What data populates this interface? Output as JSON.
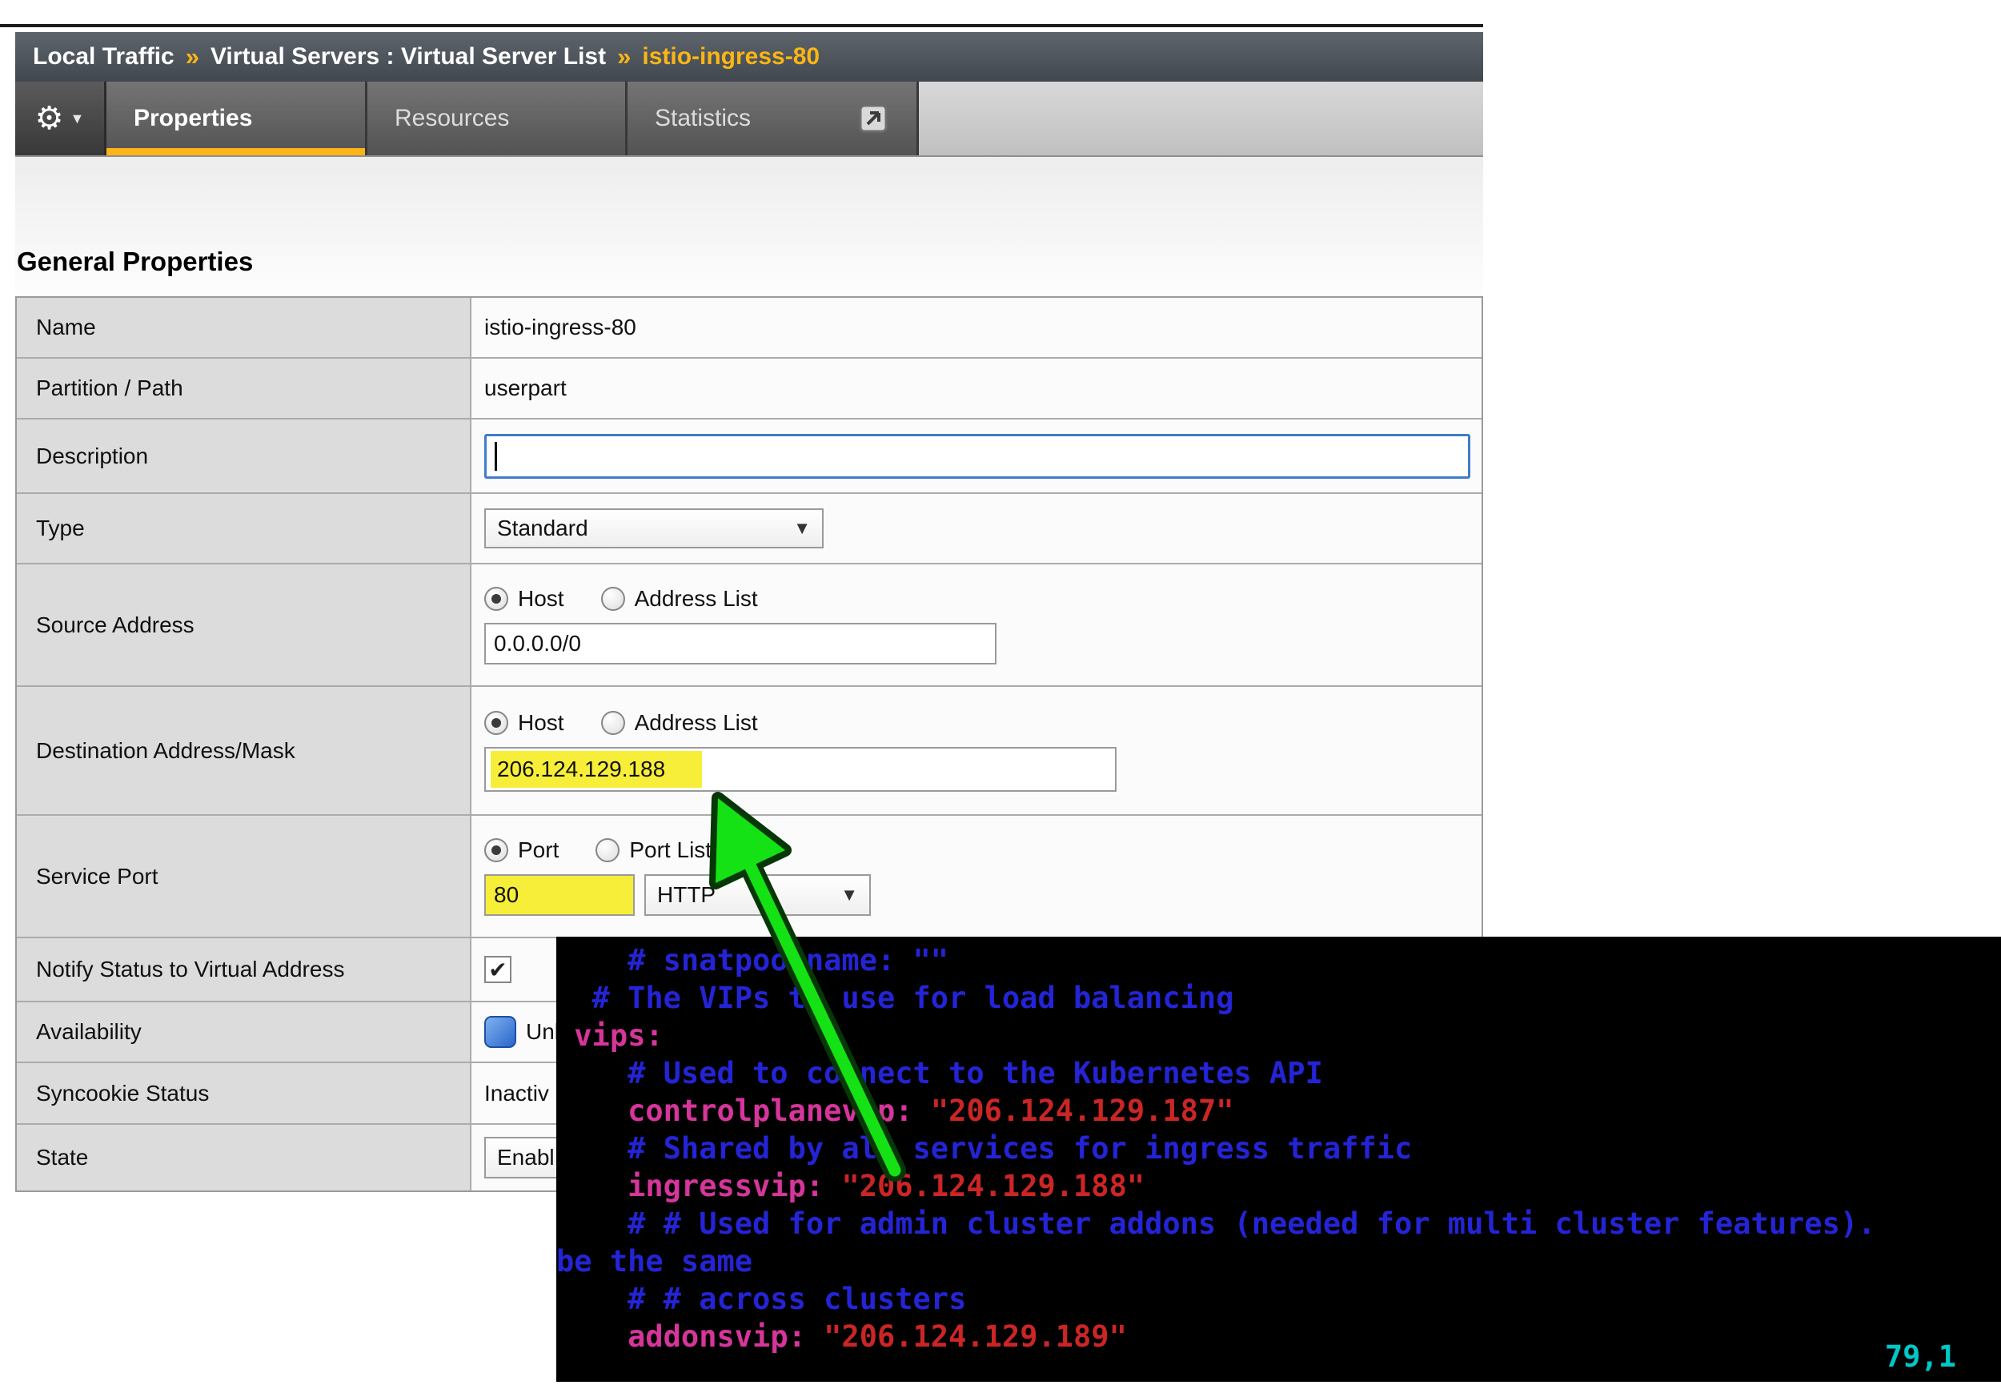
{
  "colors": {
    "accent-yellow": "#fdb515",
    "highlight": "#f7ee3a",
    "arrow-green": "#15e215",
    "term-comment": "#2424d6",
    "term-key": "#d6359b",
    "term-string": "#cc2525",
    "term-status": "#00c8c8"
  },
  "breadcrumb": {
    "section": "Local Traffic",
    "sep1": "»",
    "path": "Virtual Servers : Virtual Server List",
    "sep2": "»",
    "current": "istio-ingress-80"
  },
  "menu": {
    "gear_glyph": "⚙",
    "caret_glyph": "▼"
  },
  "tabs": [
    {
      "label": "Properties",
      "active": true
    },
    {
      "label": "Resources",
      "active": false
    },
    {
      "label": "Statistics",
      "active": false
    }
  ],
  "section_title": "General Properties",
  "ui": {
    "select_arrow": "▼",
    "check_glyph": "✔"
  },
  "form": {
    "name": {
      "label": "Name",
      "value": "istio-ingress-80"
    },
    "partition": {
      "label": "Partition / Path",
      "value": "userpart"
    },
    "description": {
      "label": "Description",
      "value": ""
    },
    "type": {
      "label": "Type",
      "value": "Standard"
    },
    "source": {
      "label": "Source Address",
      "option1": "Host",
      "option2": "Address List",
      "value": "0.0.0.0/0"
    },
    "destination": {
      "label": "Destination Address/Mask",
      "option1": "Host",
      "option2": "Address List",
      "value": "206.124.129.188"
    },
    "service_port": {
      "label": "Service Port",
      "option1": "Port",
      "option2": "Port List",
      "value": "80",
      "protocol": "HTTP"
    },
    "notify": {
      "label": "Notify Status to Virtual Address",
      "checked": true
    },
    "availability": {
      "label": "Availability",
      "value": "Unk"
    },
    "syncookie": {
      "label": "Syncookie Status",
      "value": "Inactiv"
    },
    "state": {
      "label": "State",
      "value": "Enabl"
    }
  },
  "terminal": {
    "lines": [
      [
        {
          "t": "    # snatpoolname: \"\"",
          "c": "comment"
        }
      ],
      [
        {
          "t": "  # The VIPs to use for load balancing",
          "c": "comment"
        }
      ],
      [
        {
          "t": " ",
          "c": "plain"
        },
        {
          "t": "vips:",
          "c": "key"
        }
      ],
      [
        {
          "t": "    # Used to connect to the Kubernetes API",
          "c": "comment"
        }
      ],
      [
        {
          "t": "    ",
          "c": "plain"
        },
        {
          "t": "controlplanevip:",
          "c": "key"
        },
        {
          "t": " ",
          "c": "plain"
        },
        {
          "t": "\"206.124.129.187\"",
          "c": "string"
        }
      ],
      [
        {
          "t": "    # Shared by all services for ingress traffic",
          "c": "comment"
        }
      ],
      [
        {
          "t": "    ",
          "c": "plain"
        },
        {
          "t": "ingressvip:",
          "c": "key"
        },
        {
          "t": " ",
          "c": "plain"
        },
        {
          "t": "\"206.124.129.188\"",
          "c": "string"
        }
      ],
      [
        {
          "t": "    # # Used for admin cluster addons (needed for multi cluster features).",
          "c": "comment"
        }
      ],
      [
        {
          "t": "be the same",
          "c": "comment"
        }
      ],
      [
        {
          "t": "    # # across clusters",
          "c": "comment"
        }
      ],
      [
        {
          "t": "    ",
          "c": "plain"
        },
        {
          "t": "addonsvip:",
          "c": "key"
        },
        {
          "t": " ",
          "c": "plain"
        },
        {
          "t": "\"206.124.129.189\"",
          "c": "string"
        }
      ]
    ],
    "status": "79,1"
  }
}
